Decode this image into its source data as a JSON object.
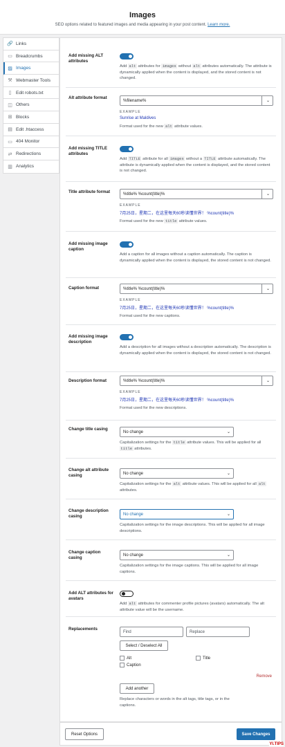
{
  "header": {
    "title": "Images",
    "subtitle": "SEO options related to featured images and media appearing in your post content.",
    "learn_more": "Learn more."
  },
  "sidebar": {
    "items": [
      {
        "label": "Links",
        "icon": "link-icon"
      },
      {
        "label": "Breadcrumbs",
        "icon": "breadcrumb-icon"
      },
      {
        "label": "Images",
        "icon": "image-icon",
        "active": true
      },
      {
        "label": "Webmaster Tools",
        "icon": "tools-icon"
      },
      {
        "label": "Edit robots.txt",
        "icon": "file-icon"
      },
      {
        "label": "Others",
        "icon": "others-icon"
      },
      {
        "label": "Blocks",
        "icon": "blocks-icon"
      },
      {
        "label": "Edit .htaccess",
        "icon": "htaccess-icon"
      },
      {
        "label": "404 Monitor",
        "icon": "monitor-icon"
      },
      {
        "label": "Redirections",
        "icon": "redirect-icon"
      },
      {
        "label": "Analytics",
        "icon": "analytics-icon"
      }
    ]
  },
  "settings": {
    "alt": {
      "label": "Add missing ALT attributes",
      "desc_a": "Add",
      "c1": "alt",
      "desc_b": "attributes for",
      "c2": "images",
      "desc_c": "without",
      "c3": "alt",
      "desc_d": "attributes automatically. The attribute is dynamically applied when the content is displayed, and the stored content is not changed."
    },
    "alt_format": {
      "label": "Alt attribute format",
      "value": "%filename%",
      "example_label": "EXAMPLE",
      "example_value": "Sunrise at Maldives",
      "desc_a": "Format used for the new",
      "code": "alt",
      "desc_b": "attribute values."
    },
    "title": {
      "label": "Add missing TITLE attributes",
      "desc_a": "Add",
      "c1": "TITLE",
      "desc_b": "attribute for all",
      "c2": "images",
      "desc_c": "without a",
      "c3": "TITLE",
      "desc_d": "attribute automatically. The attribute is dynamically applied when the content is displayed, and the stored content is not changed."
    },
    "title_format": {
      "label": "Title attribute format",
      "value": "%title% %count(title)%",
      "example_label": "EXAMPLE",
      "example_value": "7月25日，星期二，在这里每天60秒读懂世界！ %count(title)%",
      "desc_a": "Format used for the new",
      "code": "title",
      "desc_b": "attribute values."
    },
    "caption": {
      "label": "Add missing image caption",
      "desc": "Add a caption for all images without a caption automatically. The caption is dynamically applied when the content is displayed, the stored content is not changed."
    },
    "caption_format": {
      "label": "Caption format",
      "value": "%title% %count(title)%",
      "example_label": "EXAMPLE",
      "example_value": "7月25日，星期二，在这里每天60秒读懂世界！ %count(title)%",
      "desc": "Format used for the new captions."
    },
    "description": {
      "label": "Add missing image description",
      "desc": "Add a description for all images without a description automatically. The description is dynamically applied when the content is displayed, the stored content is not changed."
    },
    "description_format": {
      "label": "Description format",
      "value": "%title% %count(title)%",
      "example_label": "EXAMPLE",
      "example_value": "7月25日，星期二，在这里每天60秒读懂世界！ %count(title)%",
      "desc": "Format used for the new descriptions."
    },
    "title_casing": {
      "label": "Change title casing",
      "value": "No change",
      "desc_a": "Capitalization settings for the",
      "code": "title",
      "desc_b": "attribute values. This will be applied for all",
      "code2": "title",
      "desc_c": "attributes."
    },
    "alt_casing": {
      "label": "Change alt attribute casing",
      "value": "No change",
      "desc_a": "Capitalization settings for the",
      "code": "alt",
      "desc_b": "attribute values. This will be applied for all",
      "code2": "alt",
      "desc_c": "attributes."
    },
    "desc_casing": {
      "label": "Change description casing",
      "value": "No change",
      "desc": "Capitalization settings for the image descriptions. This will be applied for all image descriptions."
    },
    "caption_casing": {
      "label": "Change caption casing",
      "value": "No change",
      "desc": "Capitalization settings for the image captions. This will be applied for all image captions."
    },
    "avatars": {
      "label": "Add ALT attributes for avatars",
      "desc_a": "Add",
      "code": "alt",
      "desc_b": "attributes for commenter profile pictures (avatars) automatically. The alt attribute value will be the username."
    },
    "replacements": {
      "label": "Replacements",
      "find_placeholder": "Find",
      "replace_placeholder": "Replace",
      "select_all": "Select / Deselect All",
      "opt_alt": "Alt",
      "opt_title": "Title",
      "opt_caption": "Caption",
      "remove": "Remove",
      "add_another": "Add another",
      "desc": "Replace characters or words in the alt tags, title tags, or in the captions."
    }
  },
  "footer": {
    "reset": "Reset Options",
    "save": "Save Changes"
  },
  "watermark": "YI.TIPS"
}
